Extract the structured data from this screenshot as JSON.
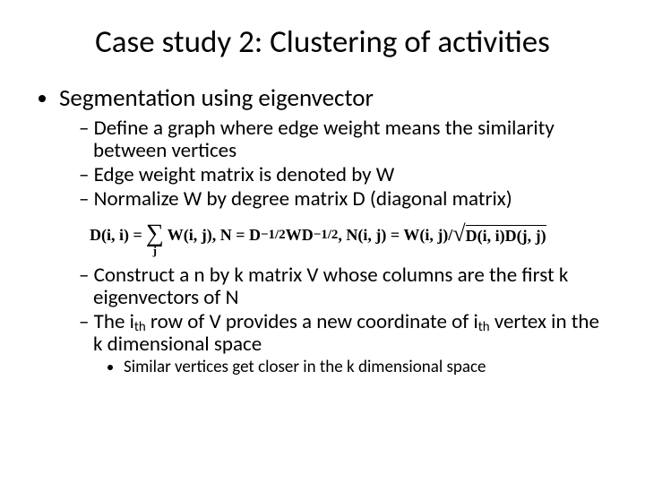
{
  "title": "Case study 2: Clustering of activities",
  "l1": {
    "i0": "Segmentation using eigenvector"
  },
  "l2": {
    "i0": " Define a graph where edge weight means the similarity between vertices",
    "i1": "Edge weight matrix is denoted by W",
    "i2": "Normalize W by degree matrix D (diagonal matrix)",
    "i3": "Construct a n by k matrix V whose columns are the first k eigenvectors of N",
    "i4_a": "The i",
    "i4_th1": "th",
    "i4_b": " row of V provides a new coordinate of i",
    "i4_th2": "th",
    "i4_c": " vertex in the k dimensional space"
  },
  "l3": {
    "i0": "Similar vertices get closer in the k dimensional space"
  },
  "formula": {
    "p1": "D(i, i) = ",
    "sigma_under": "j",
    "p2": " W(i, j), N = D",
    "exp1": "−1/2",
    "p3": "WD",
    "exp2": "−1/2",
    "p4": ", N(i, j) = W(i, j)/",
    "rad_body": "D(i, i)D(j, j)"
  }
}
